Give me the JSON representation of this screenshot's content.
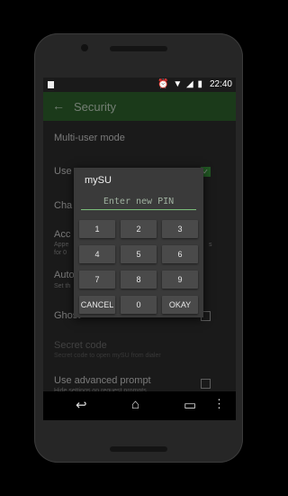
{
  "statusbar": {
    "time": "22:40",
    "icons": "⏰ ▼ ◢ ▮"
  },
  "appbar": {
    "title": "Security",
    "back_icon": "←"
  },
  "list": {
    "multiuser": "Multi-user mode",
    "use": "Use",
    "cha": "Cha",
    "acc": "Acc",
    "acc_sub1": "Appe",
    "acc_sub2": "for 0",
    "acc_sub_right": "s",
    "auto": "Auto",
    "auto_sub": "Set th",
    "ghost": "Ghost",
    "secret": "Secret code",
    "secret_sub": "Secret code to open mySU from dialer",
    "advanced": "Use advanced prompt",
    "advanced_sub": "Hide settings on request prompts"
  },
  "dialog": {
    "title": "mySU",
    "pin_placeholder": "Enter new PIN",
    "keys": [
      "1",
      "2",
      "3",
      "4",
      "5",
      "6",
      "7",
      "8",
      "9",
      "CANCEL",
      "0",
      "OKAY"
    ]
  },
  "navbar": {
    "back": "↩",
    "home": "⌂",
    "recent": "▭",
    "more": "⋮"
  }
}
